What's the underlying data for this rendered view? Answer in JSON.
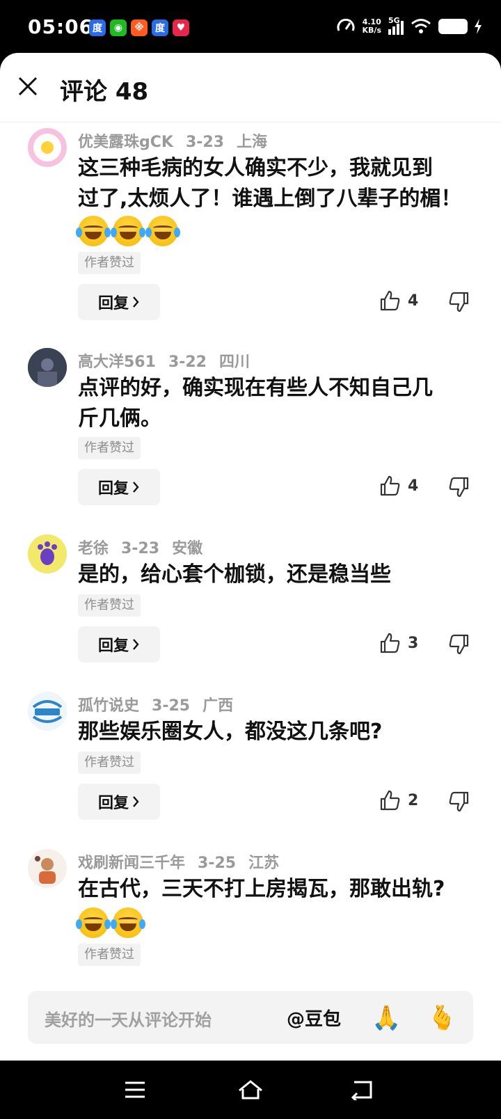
{
  "status_bar": {
    "time": "05:06",
    "net_speed_value": "4.10",
    "net_speed_unit": "KB/s",
    "network": "5G",
    "apps": [
      "baidu-icon",
      "wechat-icon",
      "orange-app-icon",
      "baidu-icon",
      "red-app-icon"
    ]
  },
  "header": {
    "title": "评论 48"
  },
  "comments": [
    {
      "user": "优美露珠gCK",
      "date": "3-23",
      "location": "上海",
      "text_line1": "这三种毛病的女人确实不少，我就见到",
      "text_line2": "过了,太烦人了！谁遇上倒了八辈子的楣！",
      "author_liked": "作者赞过",
      "reply_label": "回复",
      "likes": "4"
    },
    {
      "user": "高大洋561",
      "date": "3-22",
      "location": "四川",
      "text_line1": "点评的好，确实现在有些人不知自己几",
      "text_line2": "斤几俩。",
      "author_liked": "作者赞过",
      "reply_label": "回复",
      "likes": "4"
    },
    {
      "user": "老徐",
      "date": "3-23",
      "location": "安徽",
      "text_line1": "是的，给心套个枷锁，还是稳当些",
      "author_liked": "作者赞过",
      "reply_label": "回复",
      "likes": "3"
    },
    {
      "user": "孤竹说史",
      "date": "3-25",
      "location": "广西",
      "text_line1": "那些娱乐圈女人，都没这几条吧?",
      "author_liked": "作者赞过",
      "reply_label": "回复",
      "likes": "2"
    },
    {
      "user": "戏刷新闻三千年",
      "date": "3-25",
      "location": "江苏",
      "text_line1": "在古代，三天不打上房揭瓦，那敢出轨?",
      "author_liked": "作者赞过"
    }
  ],
  "input_bar": {
    "placeholder": "美好的一天从评论开始",
    "mention": "@豆包"
  }
}
